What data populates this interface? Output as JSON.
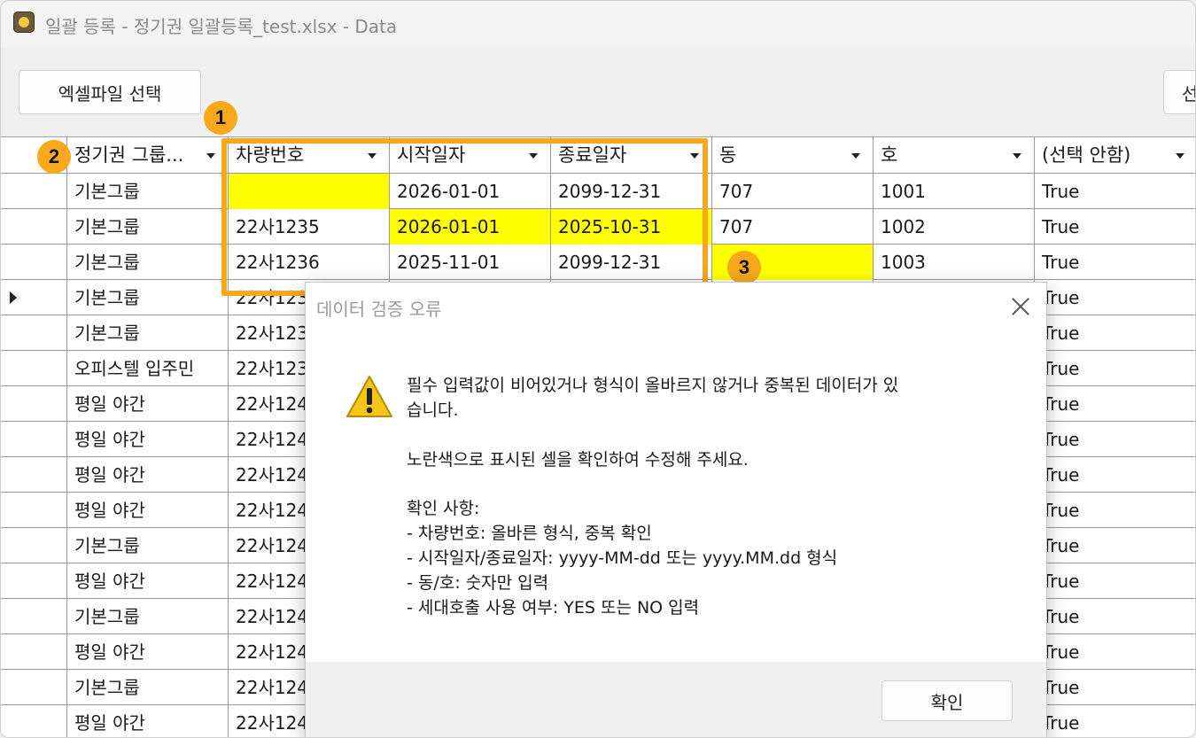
{
  "window": {
    "title": "일괄 등록 - 정기권 일괄등록_test.xlsx - Data"
  },
  "toolbar": {
    "excel_button": "엑셀파일 선택",
    "right_button_partial": "선"
  },
  "grid": {
    "headers": [
      "정기권 그룹...",
      "차량번호",
      "시작일자",
      "종료일자",
      "동",
      "호",
      "(선택 안함)"
    ],
    "rows": [
      [
        "기본그룹",
        "",
        "2026-01-01",
        "2099-12-31",
        "707",
        "1001",
        "True"
      ],
      [
        "기본그룹",
        "22사1235",
        "2026-01-01",
        "2025-10-31",
        "707",
        "1002",
        "True"
      ],
      [
        "기본그룹",
        "22사1236",
        "2025-11-01",
        "2099-12-31",
        "",
        "1003",
        "True"
      ],
      [
        "기본그룹",
        "22사123",
        "",
        "",
        "",
        "",
        "True"
      ],
      [
        "기본그룹",
        "22사123",
        "",
        "",
        "",
        "",
        "True"
      ],
      [
        "오피스텔 입주민",
        "22사123",
        "",
        "",
        "",
        "",
        "True"
      ],
      [
        "평일 야간",
        "22사124",
        "",
        "",
        "",
        "",
        "True"
      ],
      [
        "평일 야간",
        "22사124",
        "",
        "",
        "",
        "",
        "True"
      ],
      [
        "평일 야간",
        "22사124",
        "",
        "",
        "",
        "",
        "True"
      ],
      [
        "평일 야간",
        "22사124",
        "",
        "",
        "",
        "",
        "True"
      ],
      [
        "기본그룹",
        "22사124",
        "",
        "",
        "",
        "",
        "True"
      ],
      [
        "평일 야간",
        "22사124",
        "",
        "",
        "",
        "",
        "True"
      ],
      [
        "기본그룹",
        "22사124",
        "",
        "",
        "",
        "",
        "True"
      ],
      [
        "평일 야간",
        "22사124",
        "",
        "",
        "",
        "",
        "True"
      ],
      [
        "기본그룹",
        "22사124",
        "",
        "",
        "",
        "",
        "True"
      ],
      [
        "평일 야간",
        "22사124",
        "",
        "",
        "",
        "",
        "True"
      ]
    ],
    "current_row": 3,
    "error_color": "#ffff00"
  },
  "annotations": {
    "badge1": "1",
    "badge2": "2",
    "badge3": "3",
    "color": "#f7a81b"
  },
  "dialog": {
    "title": "데이터 검증 오류",
    "icon": "warning-icon",
    "lines": [
      "필수 입력값이 비어있거나 형식이 올바르지 않거나 중복된 데이터가 있",
      "습니다.",
      "노란색으로 표시된 셀을 확인하여 수정해 주세요.",
      "확인 사항:",
      "- 차량번호: 올바른 형식, 중복 확인",
      "- 시작일자/종료일자: yyyy-MM-dd 또는 yyyy.MM.dd 형식",
      "- 동/호: 숫자만 입력",
      "- 세대호출 사용 여부: YES 또는 NO 입력"
    ],
    "ok_label": "확인"
  }
}
